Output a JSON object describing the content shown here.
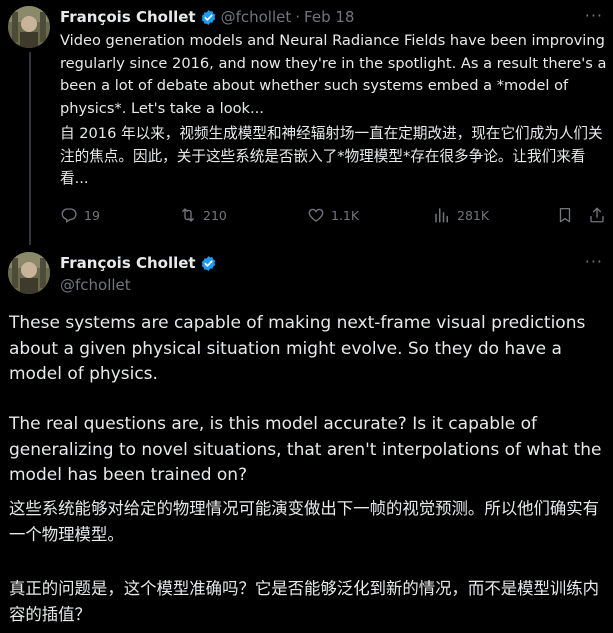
{
  "tweet1": {
    "author_name": "François Chollet",
    "handle": "@fchollet",
    "separator": "·",
    "date": "Feb 18",
    "more": "···",
    "text": "Video generation models and Neural Radiance Fields have been improving regularly since 2016, and now they're in the spotlight. As a result there's a been a lot of debate about whether such systems embed a *model of physics*. Let's take a look...",
    "translation": "自 2016 年以来，视频生成模型和神经辐射场一直在定期改进，现在它们成为人们关注的焦点。因此，关于这些系统是否嵌入了*物理模型*存在很多争论。让我们来看看...",
    "actions": {
      "replies": "19",
      "reposts": "210",
      "likes": "1.1K",
      "views": "281K"
    }
  },
  "tweet2": {
    "author_name": "François Chollet",
    "handle": "@fchollet",
    "more": "···",
    "paragraph1": "These systems are capable of making next-frame visual predictions about a given physical situation might evolve. So they do have a model of physics.",
    "paragraph2": "The real questions are, is this model accurate? Is it capable of generalizing to novel situations, that aren't interpolations of what the model has been trained on?",
    "cn_paragraph1": "这些系统能够对给定的物理情况可能演变做出下一帧的视觉预测。所以他们确实有一个物理模型。",
    "cn_paragraph2": "真正的问题是，这个模型准确吗？它是否能够泛化到新的情况，而不是模型训练内容的插值？"
  },
  "icons": {
    "verified": "verified-badge-icon",
    "reply": "reply-icon",
    "repost": "repost-icon",
    "like": "heart-icon",
    "views": "views-bar-icon",
    "bookmark": "bookmark-icon",
    "share": "share-icon"
  },
  "colors": {
    "background": "#000000",
    "text": "#e7e9ea",
    "secondary": "#71767b",
    "verified": "#1d9bf0",
    "thread_line": "#333639"
  }
}
